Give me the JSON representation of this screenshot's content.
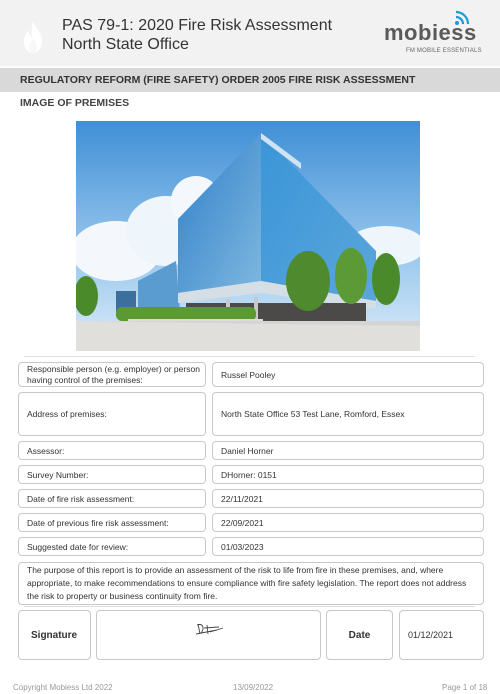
{
  "header": {
    "title_line1": "PAS 79-1: 2020 Fire Risk Assessment",
    "title_line2": "North State Office",
    "icon": "flame-icon",
    "logo": {
      "name": "mobiess",
      "tagline": "FM MOBILE ESSENTIALS",
      "accent_color": "#1a9ad6"
    }
  },
  "banner": {
    "text": "REGULATORY REFORM (FIRE SAFETY) ORDER 2005 FIRE RISK ASSESSMENT"
  },
  "image_section": {
    "title": "IMAGE OF PREMISES",
    "image_description": "Modern glass office building under blue sky with clouds"
  },
  "fields": [
    {
      "label": "Responsible person (e.g. employer) or person having control of the premises:",
      "value": "Russel Pooley"
    },
    {
      "label": "Address of premises:",
      "value": "North State Office 53 Test Lane, Romford, Essex"
    },
    {
      "label": "Assessor:",
      "value": "Daniel Horner"
    },
    {
      "label": "Survey Number:",
      "value": "DHorner: 0151"
    },
    {
      "label": "Date of fire risk assessment:",
      "value": "22/11/2021"
    },
    {
      "label": "Date of previous fire risk assessment:",
      "value": "22/09/2021"
    },
    {
      "label": "Suggested date for review:",
      "value": "01/03/2023"
    }
  ],
  "purpose": "The purpose of this report is to provide an assessment of the risk to life from fire in these premises, and, where appropriate, to make recommendations to ensure compliance with fire safety legislation. The report does not address the risk to property or business continuity from fire.",
  "signature": {
    "label": "Signature",
    "date_label": "Date",
    "date_value": "01/12/2021"
  },
  "footer": {
    "copyright": "Copyright Mobiess Ltd 2022",
    "date": "13/09/2022",
    "page": "Page 1 of 18"
  }
}
